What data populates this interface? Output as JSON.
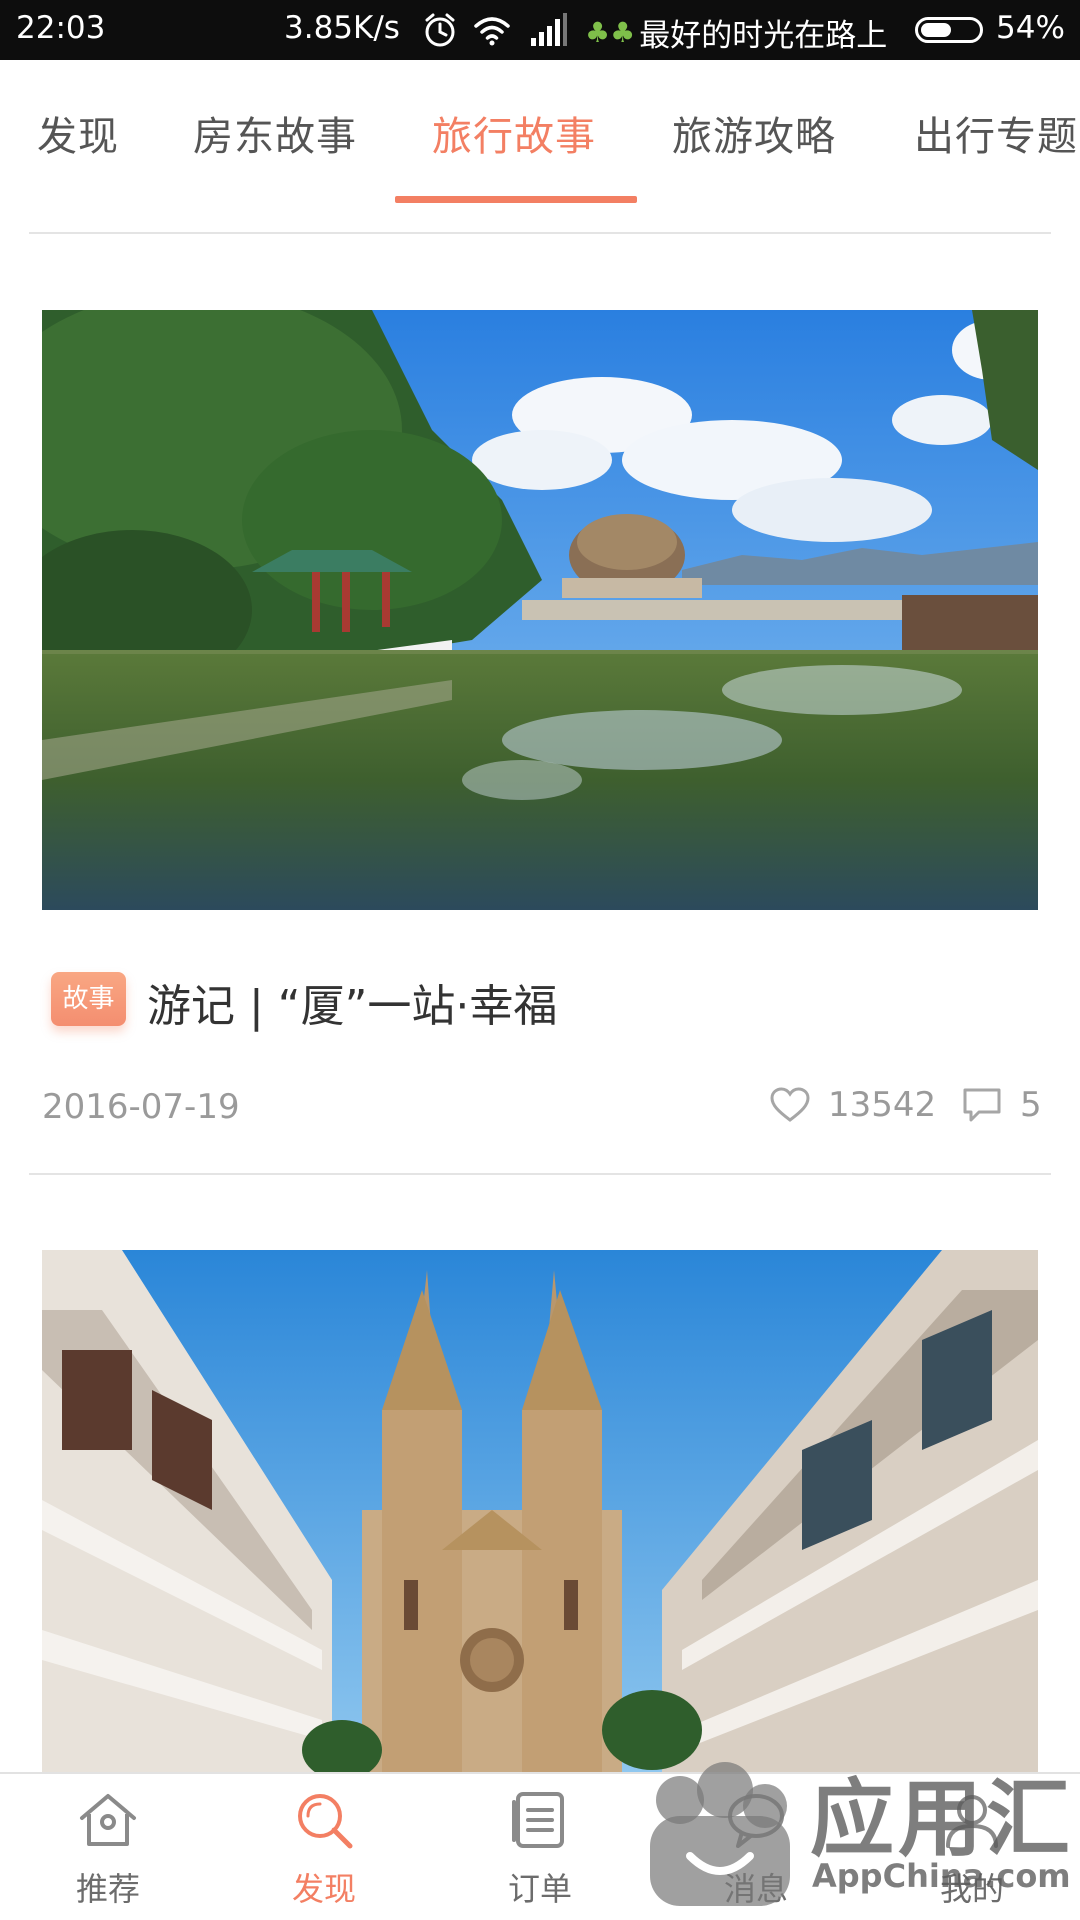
{
  "status_bar": {
    "time": "22:03",
    "network_speed": "3.85K/s",
    "carrier": "最好的时光在路上",
    "battery_percent": "54%",
    "battery_level": 0.54
  },
  "tabs": [
    {
      "label": "发现",
      "active": false
    },
    {
      "label": "房东故事",
      "active": false
    },
    {
      "label": "旅行故事",
      "active": true
    },
    {
      "label": "旅游攻略",
      "active": false
    },
    {
      "label": "出行专题",
      "active": false
    }
  ],
  "cards": [
    {
      "badge": "故事",
      "title": "游记 | “厦”一站·幸福",
      "date": "2016-07-19",
      "likes": "13542",
      "comments": "5"
    }
  ],
  "bottom_nav": [
    {
      "label": "推荐",
      "icon": "home-icon",
      "active": false
    },
    {
      "label": "发现",
      "icon": "search-icon",
      "active": true
    },
    {
      "label": "订单",
      "icon": "order-list-icon",
      "active": false
    },
    {
      "label": "消息",
      "icon": "message-icon",
      "active": false
    },
    {
      "label": "我的",
      "icon": "profile-icon",
      "active": false
    }
  ],
  "watermark": {
    "title": "应用汇",
    "subtitle": "AppChina.com"
  },
  "colors": {
    "accent": "#f37f63",
    "text_primary": "#333333",
    "text_secondary": "#9a9a9a",
    "divider": "#e4e4e4"
  }
}
